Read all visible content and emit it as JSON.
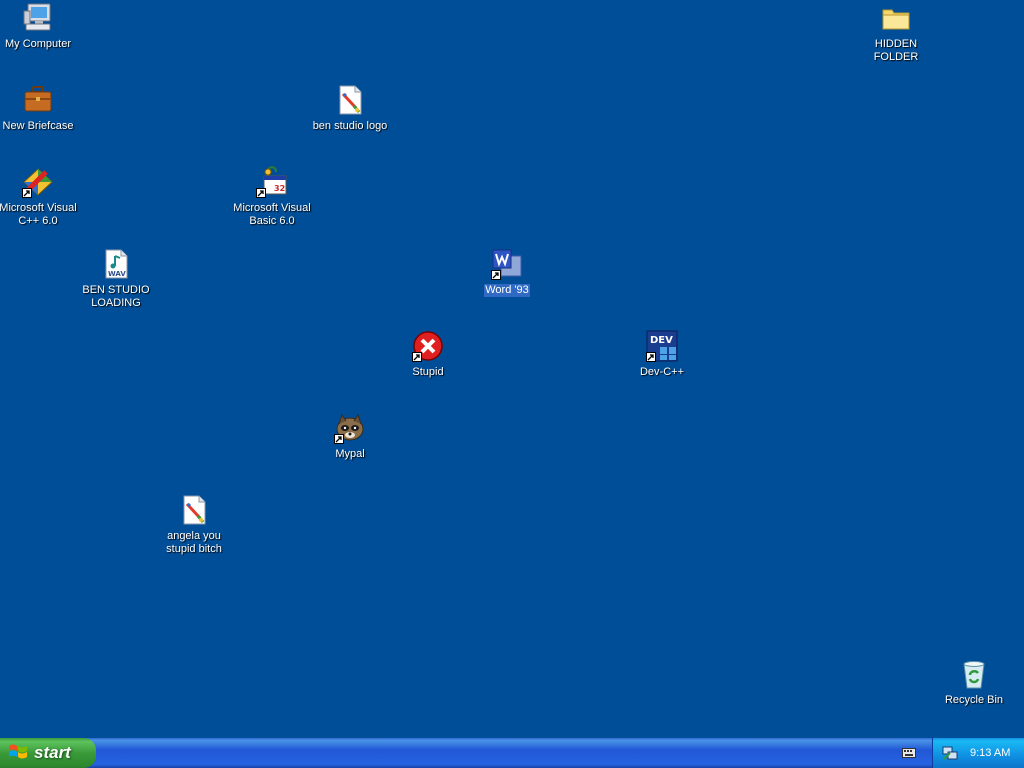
{
  "desktop": {
    "background_color": "#004e98",
    "icons": {
      "my_computer": "My Computer",
      "hidden_folder": "HIDDEN FOLDER",
      "new_briefcase": "New Briefcase",
      "ben_studio_logo": "ben studio logo",
      "visual_cpp": "Microsoft Visual C++ 6.0",
      "visual_basic": "Microsoft Visual Basic 6.0",
      "ben_studio_loading": "BEN STUDIO LOADING",
      "word93": "Word '93",
      "stupid": "Stupid",
      "dev_cpp": "Dev-C++",
      "mypal": "Mypal",
      "angela": "angela you stupid bitch",
      "recycle_bin": "Recycle Bin"
    },
    "wav_badge": "WAV",
    "dev_badge": "DEV",
    "vb_badge": "32"
  },
  "taskbar": {
    "start_label": "start",
    "clock": "9:13 AM",
    "colors": {
      "taskbar_blue": "#2663e0",
      "start_green": "#3a9a3a",
      "tray_blue": "#0f8fe3"
    }
  }
}
